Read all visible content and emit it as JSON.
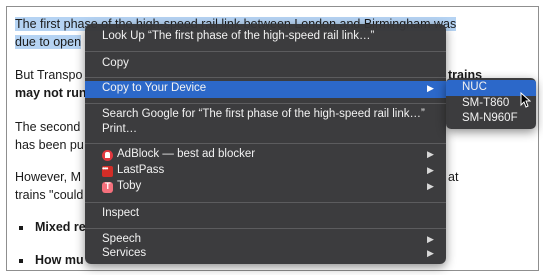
{
  "article": {
    "lines": [
      "The first phase of the high-speed rail link between London and Birmingham was",
      "due to open",
      "But Transpo",
      "trains",
      "may not run",
      "The second",
      "has been pu",
      "However, M",
      "at",
      "trains \"could",
      "Mixed re",
      "How mu"
    ]
  },
  "context_menu": {
    "look_up": "Look Up “The first phase of the high-speed rail link…”",
    "copy": "Copy",
    "copy_to_device": "Copy to Your Device",
    "search_google": "Search Google for “The first phase of the high-speed rail link…”",
    "print": "Print…",
    "adblock": "AdBlock — best ad blocker",
    "lastpass": "LastPass",
    "toby": "Toby",
    "inspect": "Inspect",
    "speech": "Speech",
    "services": "Services",
    "arrow": "▶"
  },
  "submenu": {
    "devices": [
      "NUC",
      "SM-T860",
      "SM-N960F"
    ]
  },
  "icons": {
    "adblock": "adblock-icon",
    "lastpass": "lastpass-icon",
    "toby": "toby-icon",
    "submenu_arrow": "chevron-right-icon",
    "cursor": "mouse-pointer-icon"
  },
  "colors": {
    "selection_highlight": "#b5d3f3",
    "menu_background": "#363638",
    "menu_active": "#2c68c9"
  }
}
